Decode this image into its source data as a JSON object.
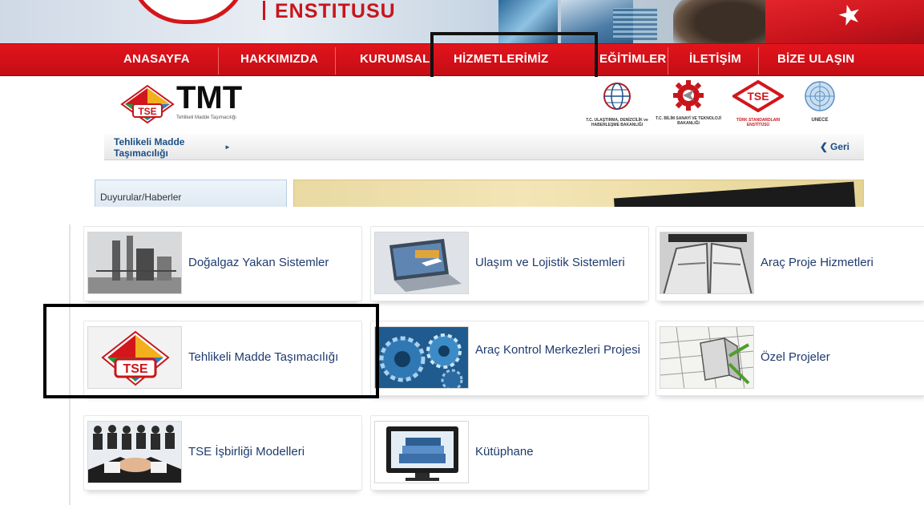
{
  "header": {
    "institute_text": "ENSTITUSU"
  },
  "nav": {
    "items": [
      {
        "label": "ANASAYFA"
      },
      {
        "label": "HAKKIMIZDA"
      },
      {
        "label": "KURUMSAL"
      },
      {
        "label": "HİZMETLERİMİZ"
      },
      {
        "label": "EĞİTİMLER"
      },
      {
        "label": "İLETİŞİM"
      },
      {
        "label": "BİZE ULAŞIN"
      }
    ]
  },
  "tmt": {
    "logo_text": "TMT",
    "logo_subtitle": "Tehlikeli Madde Taşımacılığı",
    "badge_text": "TSE"
  },
  "partners": [
    {
      "caption": "T.C. ULAŞTIRMA, DENİZCİLİK ve HABERLEŞME BAKANLIĞI",
      "icon": "ministry-transport-logo"
    },
    {
      "caption": "T.C. BİLİM SANAYİ VE TEKNOLOJİ BAKANLIĞI",
      "icon": "ministry-science-gear-logo"
    },
    {
      "caption": "TÜRK STANDARDLARI ENSTİTÜSÜ",
      "icon": "tse-logo"
    },
    {
      "caption": "UNECE",
      "icon": "un-emblem-logo"
    }
  ],
  "breadcrumb": {
    "current": "Tehlikeli Madde Taşımacılığı",
    "back_label": "Geri"
  },
  "sidebar": {
    "news_label": "Duyurular/Haberler"
  },
  "services": [
    {
      "label": "Doğalgaz Yakan Sistemler",
      "thumb": "gas-plant-image"
    },
    {
      "label": "Ulaşım ve Lojistik Sistemleri",
      "thumb": "laptop-logistics-image"
    },
    {
      "label": "Araç Proje Hizmetleri",
      "thumb": "car-interior-image"
    },
    {
      "label": "Tehlikeli Madde Taşımacılığı",
      "thumb": "tse-diamond-logo"
    },
    {
      "label": "Araç Kontrol Merkezleri Projesi",
      "thumb": "gears-image"
    },
    {
      "label": "Özel Projeler",
      "thumb": "blueprint-building-image"
    },
    {
      "label": "TSE İşbirliği Modelleri",
      "thumb": "handshake-image"
    },
    {
      "label": "Kütüphane",
      "thumb": "books-monitor-image"
    }
  ],
  "colors": {
    "nav_red": "#d3111a",
    "link_blue": "#1f3b6e",
    "highlight": "#000000"
  }
}
